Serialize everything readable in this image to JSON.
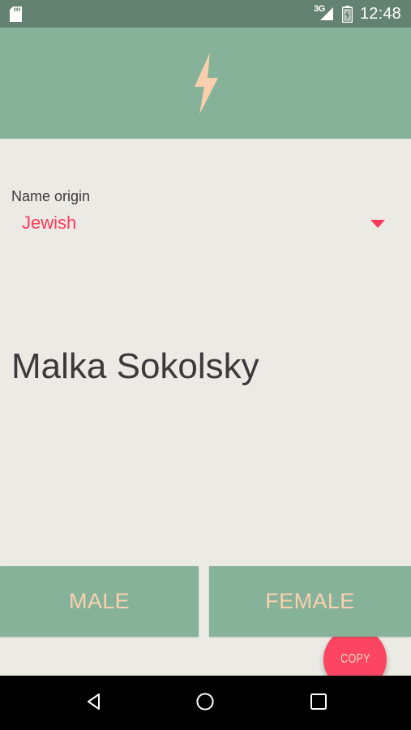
{
  "status_bar": {
    "sd_card_icon": "sd-card-icon",
    "network_label": "3G",
    "signal_icon": "signal-bars-icon",
    "battery_icon": "battery-charging-icon",
    "time": "12:48",
    "background_color": "#648271",
    "foreground_color": "#ffffff"
  },
  "header": {
    "logo_icon": "lightning-bolt-icon",
    "background_color": "#86b29a",
    "logo_color": "#fbcfae"
  },
  "form": {
    "origin_label": "Name origin",
    "origin_value": "Jewish",
    "origin_caret_icon": "chevron-down-icon",
    "accent_color": "#fb3b5c"
  },
  "result": {
    "generated_name": "Malka Sokolsky",
    "text_color": "#3a3a3a"
  },
  "actions": {
    "copy_label": "COPY",
    "copy_background": "#fb4562",
    "copy_text_color": "#fbd9bd",
    "male_label": "MALE",
    "female_label": "FEMALE",
    "gender_background": "#86b29a",
    "gender_text_color": "#fbd0ae"
  },
  "navigation_bar": {
    "back_icon": "back-triangle-icon",
    "home_icon": "home-circle-icon",
    "recents_icon": "recents-square-icon",
    "background_color": "#000000",
    "icon_color": "#ffffff"
  },
  "page": {
    "background_color": "#eceae5"
  }
}
